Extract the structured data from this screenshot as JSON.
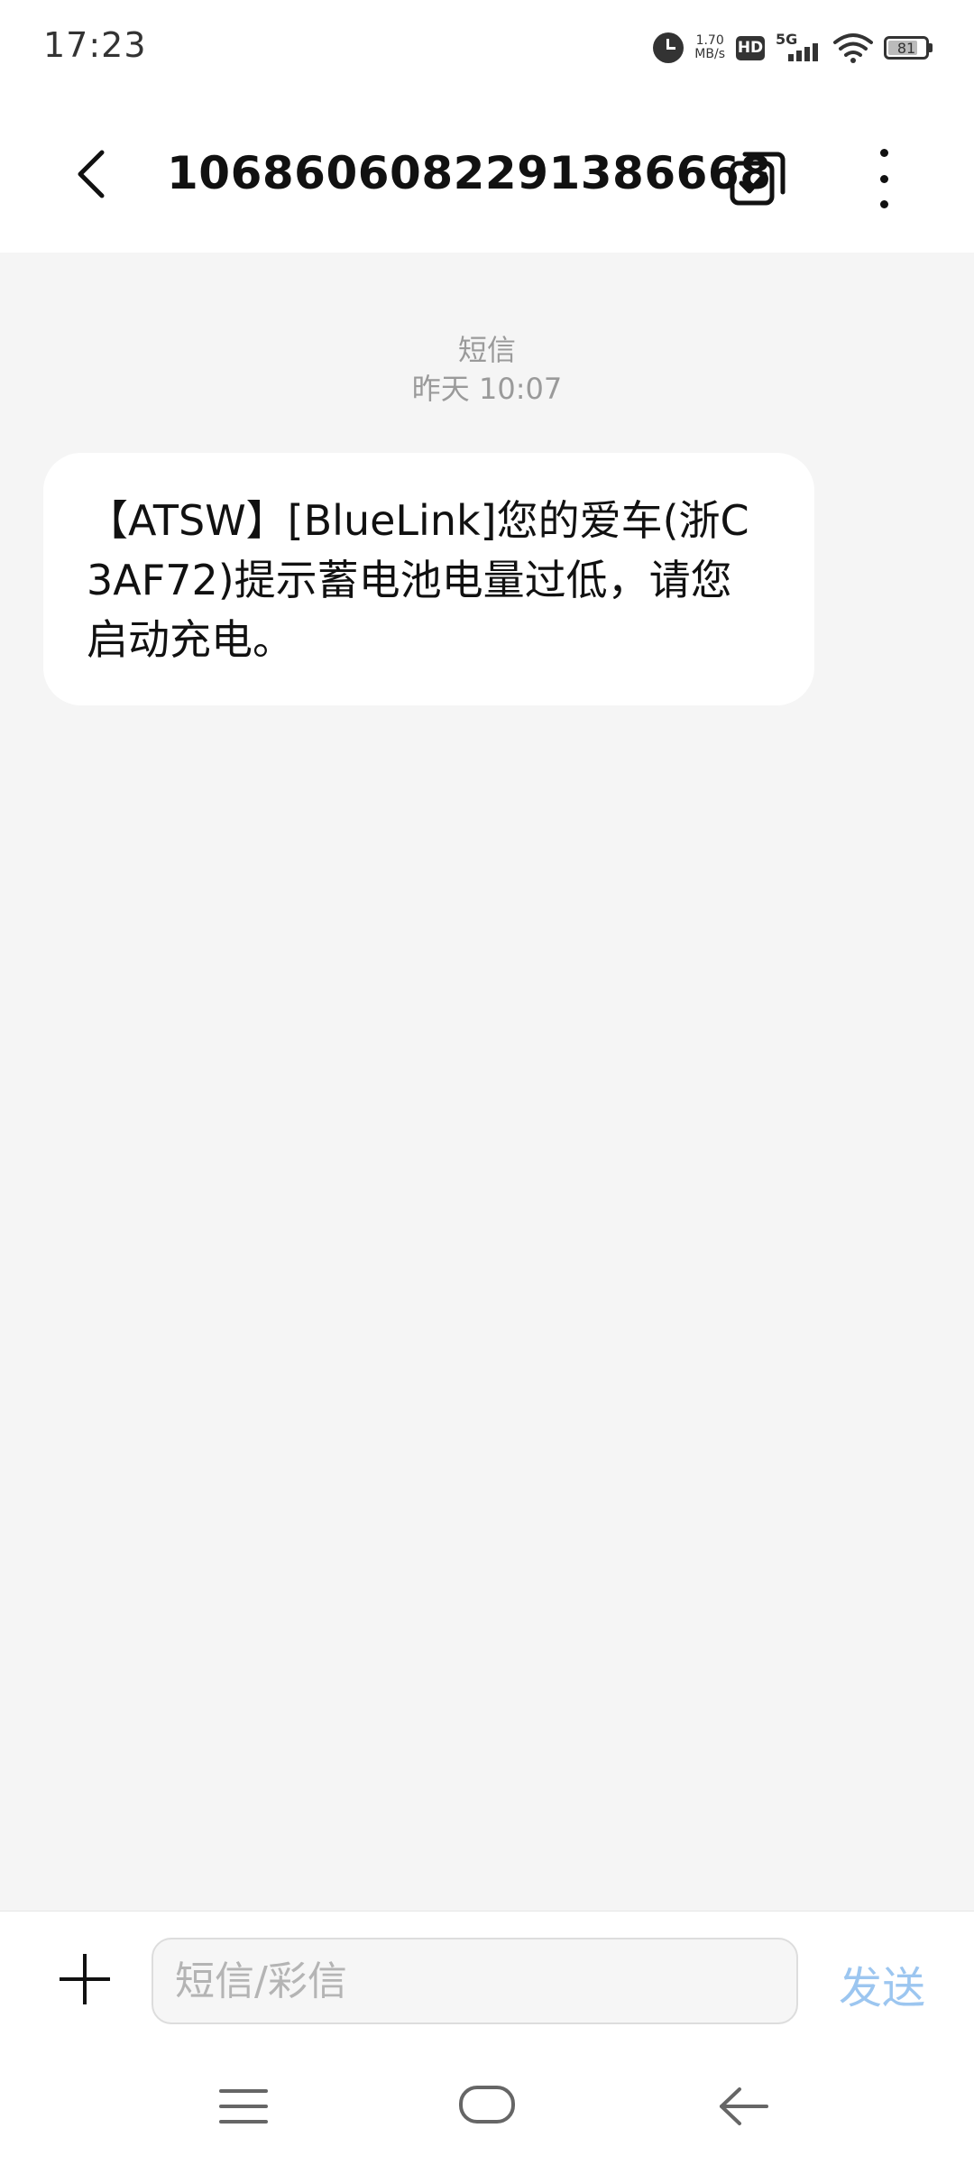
{
  "status_bar": {
    "time": "17:23",
    "net_speed_value": "1.70",
    "net_speed_unit": "MB/s",
    "hd_label": "HD",
    "network_label": "5G",
    "battery_level": "81",
    "icons": [
      "alarm-icon",
      "hd-icon",
      "signal-icon",
      "wifi-icon",
      "battery-icon"
    ]
  },
  "header": {
    "title": "1068606082291386668",
    "back_icon": "chevron-left-icon",
    "multiselect_icon": "checkbox-multiselect-icon",
    "more_icon": "more-vertical-icon"
  },
  "conversation": {
    "message_type": "短信",
    "timestamp": "昨天 10:07",
    "messages": [
      {
        "direction": "incoming",
        "text": "【ATSW】[BlueLink]您的爱车(浙C3AF72)提示蓄电池电量过低，请您启动充电。"
      }
    ]
  },
  "composer": {
    "placeholder": "短信/彩信",
    "value": "",
    "send_label": "发送",
    "add_icon": "plus-icon",
    "send_color": "#9cc6f0"
  },
  "nav_bar": {
    "icons": [
      "menu-icon",
      "home-icon",
      "back-arrow-icon"
    ]
  },
  "colors": {
    "background": "#f5f5f5",
    "bubble": "#ffffff",
    "meta_text": "#9a9a9a"
  }
}
